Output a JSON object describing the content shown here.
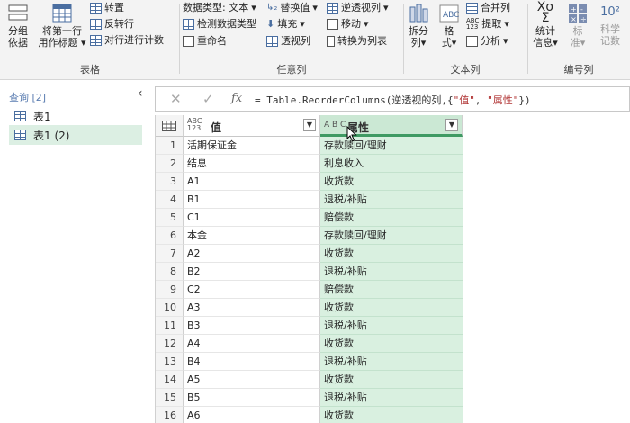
{
  "ribbon": {
    "table_group": {
      "label": "表格",
      "group_by_line1": "分组",
      "group_by_line2": "依据",
      "first_row_line1": "将第一行",
      "first_row_line2": "用作标题",
      "transpose": "转置",
      "reverse_rows": "反转行",
      "count_rows": "对行进行计数"
    },
    "any_column_group": {
      "label": "任意列",
      "data_type": "数据类型: 文本",
      "detect_type": "检测数据类型",
      "rename": "重命名",
      "replace_values": "替换值",
      "fill": "填充",
      "pivot_column": "透视列",
      "unpivot_columns": "逆透视列",
      "move": "移动",
      "convert_to_list": "转换为列表"
    },
    "text_column_group": {
      "label": "文本列",
      "split_column_line1": "拆分",
      "split_column_line2": "列",
      "format_line1": "格",
      "format_line2": "式",
      "merge_columns": "合并列",
      "extract": "提取",
      "parse": "分析"
    },
    "number_column_group": {
      "label": "编号列",
      "statistics_line1": "统计",
      "statistics_line2": "信息",
      "standard_line1": "标",
      "standard_line2": "准",
      "scientific_line1": "科学",
      "scientific_line2": "记数"
    }
  },
  "queries": {
    "header": "查询 [2]",
    "items": [
      {
        "label": "表1"
      },
      {
        "label": "表1 (2)"
      }
    ]
  },
  "formula_bar": {
    "prefix": "= Table.ReorderColumns(逆透视的列,{",
    "str1": "\"值\"",
    "comma": ", ",
    "str2": "\"属性\"",
    "suffix": "})"
  },
  "grid": {
    "columns": [
      {
        "type_icon_line1": "ABC",
        "type_icon_line2": "123",
        "name": "值"
      },
      {
        "type_icon": "A B C",
        "name": "属性"
      }
    ],
    "rows": [
      {
        "n": "1",
        "value": "活期保证金",
        "attr": "存款赎回/理财"
      },
      {
        "n": "2",
        "value": "结息",
        "attr": "利息收入"
      },
      {
        "n": "3",
        "value": "A1",
        "attr": "收货款"
      },
      {
        "n": "4",
        "value": "B1",
        "attr": "退税/补贴"
      },
      {
        "n": "5",
        "value": "C1",
        "attr": "赔偿款"
      },
      {
        "n": "6",
        "value": "本金",
        "attr": "存款赎回/理财"
      },
      {
        "n": "7",
        "value": "A2",
        "attr": "收货款"
      },
      {
        "n": "8",
        "value": "B2",
        "attr": "退税/补贴"
      },
      {
        "n": "9",
        "value": "C2",
        "attr": "赔偿款"
      },
      {
        "n": "10",
        "value": "A3",
        "attr": "收货款"
      },
      {
        "n": "11",
        "value": "B3",
        "attr": "退税/补贴"
      },
      {
        "n": "12",
        "value": "A4",
        "attr": "收货款"
      },
      {
        "n": "13",
        "value": "B4",
        "attr": "退税/补贴"
      },
      {
        "n": "14",
        "value": "A5",
        "attr": "收货款"
      },
      {
        "n": "15",
        "value": "B5",
        "attr": "退税/补贴"
      },
      {
        "n": "16",
        "value": "A6",
        "attr": "收货款"
      }
    ]
  },
  "colors": {
    "selected_column": "#d9f0e0",
    "selected_header": "#cbe8d4",
    "accent_green": "#3f9a63",
    "query_header": "#5b7db1"
  }
}
